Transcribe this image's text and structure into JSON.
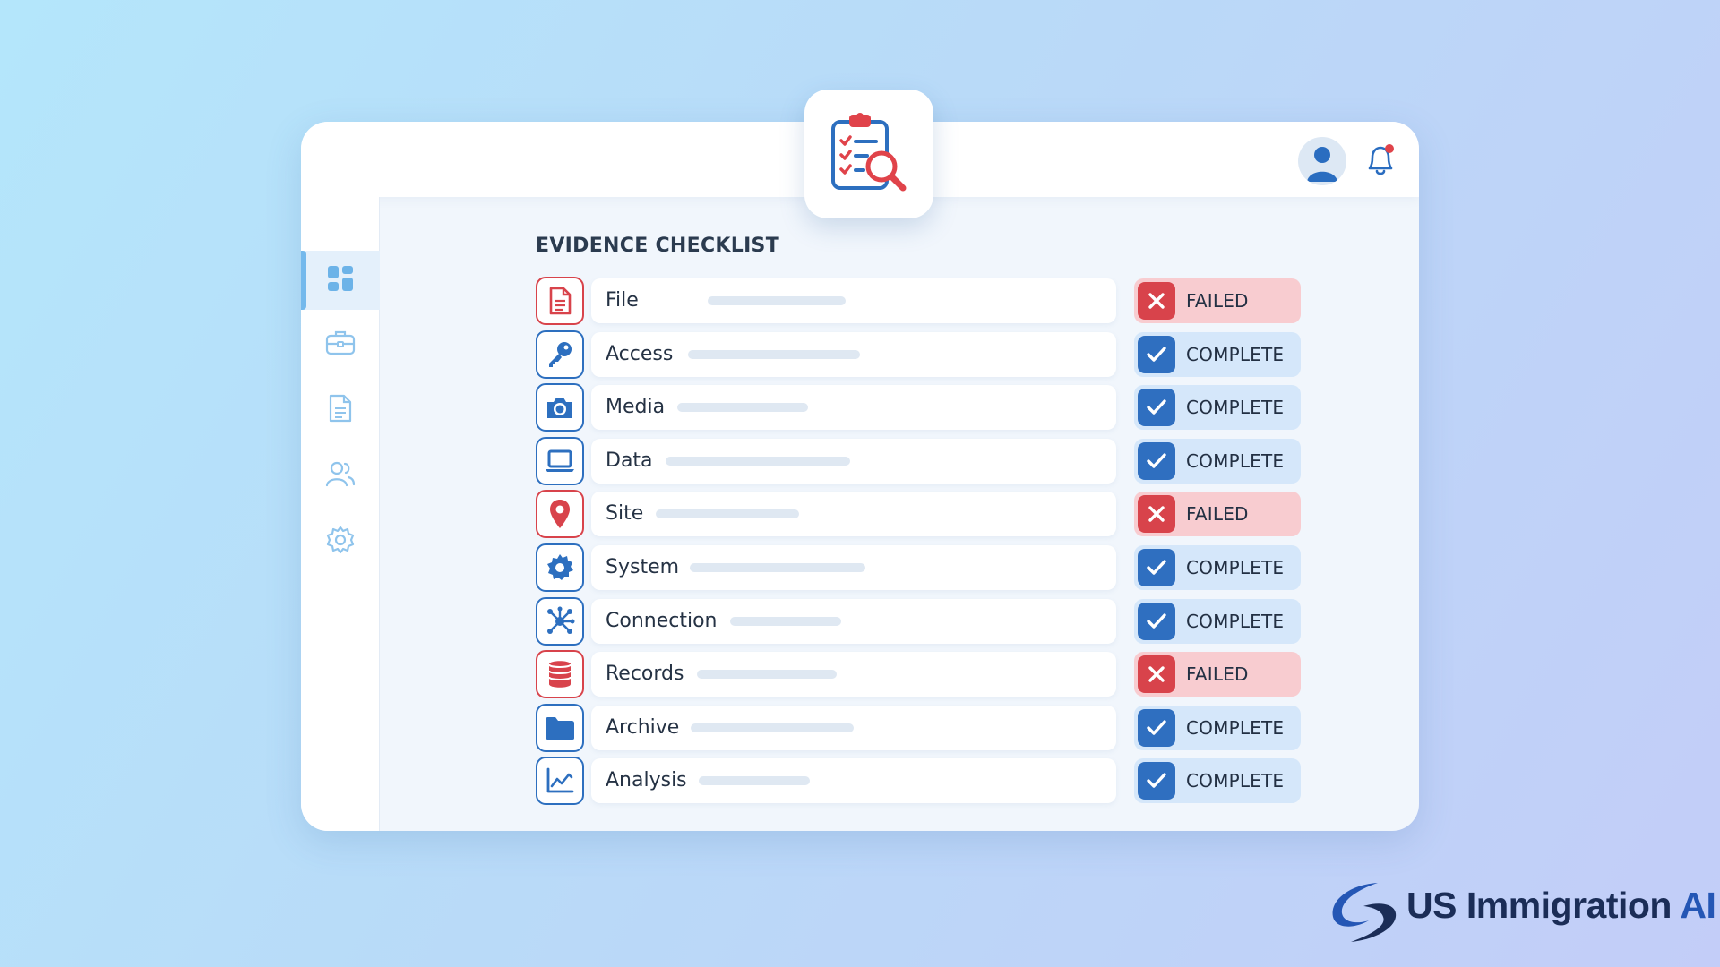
{
  "header": {
    "badge_icon": "clipboard-search-icon",
    "avatar_icon": "user-avatar-icon",
    "notification_icon": "bell-icon"
  },
  "sidebar": {
    "items": [
      {
        "icon": "dashboard-icon",
        "active": true
      },
      {
        "icon": "briefcase-icon",
        "active": false
      },
      {
        "icon": "document-icon",
        "active": false
      },
      {
        "icon": "users-icon",
        "active": false
      },
      {
        "icon": "gear-icon",
        "active": false
      }
    ]
  },
  "checklist": {
    "title": "EVIDENCE CHECKLIST",
    "items": [
      {
        "label": "File",
        "icon": "file-icon",
        "status": "FAILED"
      },
      {
        "label": "Access",
        "icon": "key-icon",
        "status": "COMPLETE"
      },
      {
        "label": "Media",
        "icon": "camera-icon",
        "status": "COMPLETE"
      },
      {
        "label": "Data",
        "icon": "laptop-icon",
        "status": "COMPLETE"
      },
      {
        "label": "Site",
        "icon": "location-pin-icon",
        "status": "FAILED"
      },
      {
        "label": "System",
        "icon": "gear-icon",
        "status": "COMPLETE"
      },
      {
        "label": "Connection",
        "icon": "network-icon",
        "status": "COMPLETE"
      },
      {
        "label": "Records",
        "icon": "database-icon",
        "status": "FAILED"
      },
      {
        "label": "Archive",
        "icon": "folder-icon",
        "status": "COMPLETE"
      },
      {
        "label": "Analysis",
        "icon": "line-chart-icon",
        "status": "COMPLETE"
      }
    ]
  },
  "colors": {
    "complete": "#2f6fc0",
    "failed": "#d8434b",
    "complete_bg": "#d5e7fa",
    "failed_bg": "#f8ccd0"
  },
  "logo": {
    "text_main": "US Immigration",
    "text_accent": "AI"
  }
}
